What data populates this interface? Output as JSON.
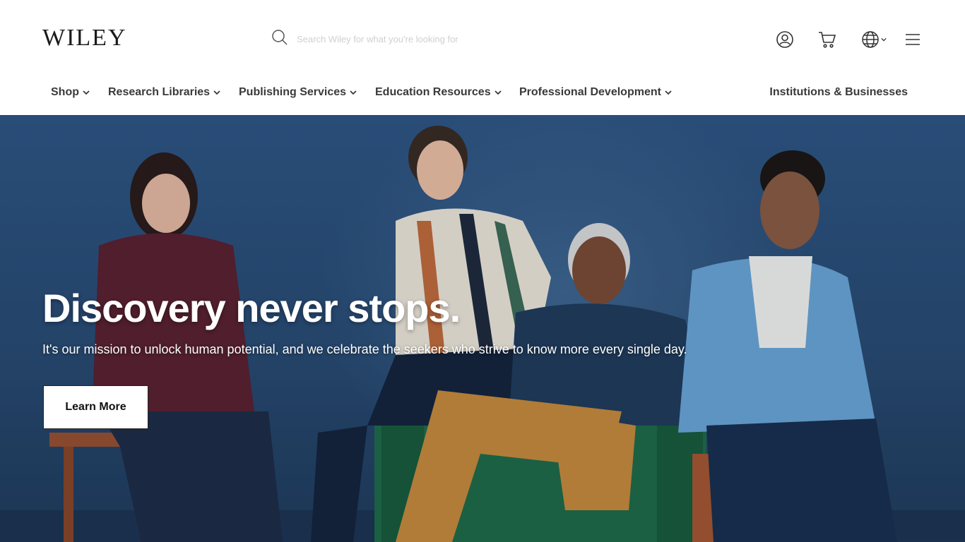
{
  "brand": {
    "logo_text": "WILEY"
  },
  "search": {
    "placeholder": "Search Wiley for what you're looking for"
  },
  "header_icons": [
    "account-icon",
    "cart-icon",
    "globe-icon",
    "menu-icon"
  ],
  "nav": {
    "items": [
      {
        "label": "Shop"
      },
      {
        "label": "Research Libraries"
      },
      {
        "label": "Publishing Services"
      },
      {
        "label": "Education Resources"
      },
      {
        "label": "Professional Development"
      }
    ],
    "right_link": "Institutions & Businesses"
  },
  "hero": {
    "title": "Discovery never stops.",
    "subtitle": "It's our mission to unlock human potential, and we celebrate the seekers who strive to know more every single day.",
    "cta_label": "Learn More"
  },
  "colors": {
    "hero_background": "#2e5583",
    "text_dark": "#3a3a3a",
    "cta_background": "#ffffff"
  }
}
